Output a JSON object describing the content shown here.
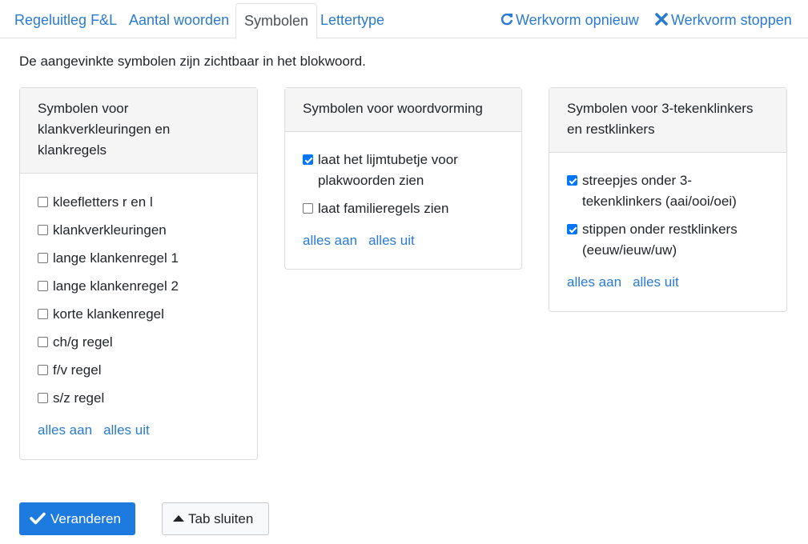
{
  "tabs": [
    {
      "label": "Regeluitleg F&L"
    },
    {
      "label": "Aantal woorden"
    },
    {
      "label": "Symbolen",
      "active": true
    },
    {
      "label": "Lettertype"
    }
  ],
  "actions": {
    "restart": {
      "icon": "refresh-icon",
      "label": "Werkvorm opnieuw"
    },
    "stop": {
      "icon": "close-icon",
      "label": "Werkvorm stoppen"
    }
  },
  "intro": "De aangevinkte symbolen zijn zichtbaar in het blokwoord.",
  "cards": [
    {
      "title": "Symbolen voor klankverkleuringen en klankregels",
      "options": [
        {
          "label": "kleefletters r en l",
          "checked": false
        },
        {
          "label": "klankverkleuringen",
          "checked": false
        },
        {
          "label": "lange klankenregel 1",
          "checked": false
        },
        {
          "label": "lange klankenregel 2",
          "checked": false
        },
        {
          "label": "korte klankenregel",
          "checked": false
        },
        {
          "label": "ch/g regel",
          "checked": false
        },
        {
          "label": "f/v regel",
          "checked": false
        },
        {
          "label": "s/z regel",
          "checked": false
        }
      ],
      "all_on": "alles aan",
      "all_off": "alles uit"
    },
    {
      "title": "Symbolen voor woordvorming",
      "options": [
        {
          "label": "laat het lijmtubetje voor plakwoorden zien",
          "checked": true
        },
        {
          "label": "laat familieregels zien",
          "checked": false
        }
      ],
      "all_on": "alles aan",
      "all_off": "alles uit"
    },
    {
      "title": "Symbolen voor 3-tekenklinkers en restklinkers",
      "options": [
        {
          "label": "streepjes onder 3-tekenklinkers (aai/ooi/oei)",
          "checked": true
        },
        {
          "label": "stippen onder restklinkers (eeuw/ieuw/uw)",
          "checked": true
        }
      ],
      "all_on": "alles aan",
      "all_off": "alles uit"
    }
  ],
  "buttons": {
    "change": {
      "icon": "checkmark-icon",
      "label": "Veranderen"
    },
    "close_tab": {
      "icon": "caret-up-icon",
      "label": "Tab sluiten"
    }
  },
  "colors": {
    "link": "#2a7ad1",
    "primary": "#1d7be0",
    "checkbox": "#0075ff"
  }
}
